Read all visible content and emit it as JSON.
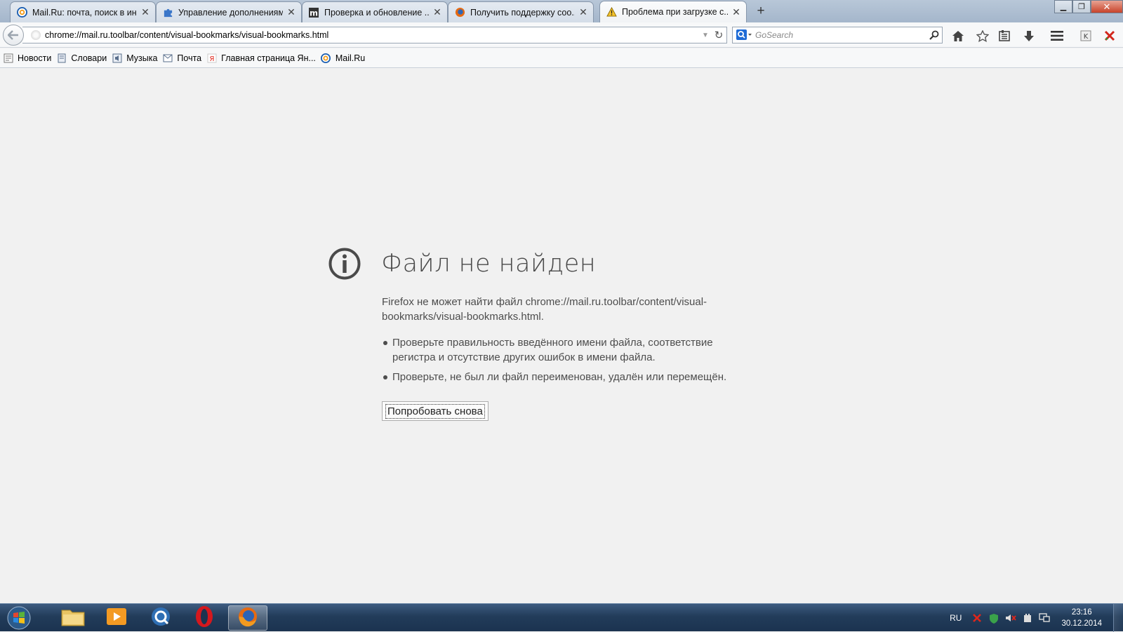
{
  "tabs": [
    {
      "label": "Mail.Ru: почта, поиск в ин...",
      "icon": "mailru-at-icon"
    },
    {
      "label": "Управление дополнениями",
      "icon": "puzzle-icon"
    },
    {
      "label": "Проверка и обновление ...",
      "icon": "m-letter-icon"
    },
    {
      "label": "Получить поддержку соо...",
      "icon": "firefox-icon"
    },
    {
      "label": "Проблема при загрузке с...",
      "icon": "warning-icon",
      "active": true
    }
  ],
  "urlbar": {
    "value": "chrome://mail.ru.toolbar/content/visual-bookmarks/visual-bookmarks.html"
  },
  "search": {
    "placeholder": "GoSearch"
  },
  "bookmarks": [
    {
      "label": "Новости",
      "icon": "news-icon"
    },
    {
      "label": "Словари",
      "icon": "dictionary-icon"
    },
    {
      "label": "Музыка",
      "icon": "music-icon"
    },
    {
      "label": "Почта",
      "icon": "mail-icon"
    },
    {
      "label": "Главная страница Ян...",
      "icon": "yandex-icon"
    },
    {
      "label": "Mail.Ru",
      "icon": "mailru-at-icon"
    }
  ],
  "error": {
    "title": "Файл не найден",
    "description": "Firefox не может найти файл chrome://mail.ru.toolbar/content/visual-bookmarks/visual-bookmarks.html.",
    "hints": [
      "Проверьте правильность введённого имени файла, соответствие регистра и отсутствие других ошибок в имени файла.",
      "Проверьте, не был ли файл переименован, удалён или перемещён."
    ],
    "retry_label": "Попробовать снова"
  },
  "taskbar": {
    "language": "RU",
    "time": "23:16",
    "date": "30.12.2014"
  },
  "colors": {
    "tabbar": "#a4b6cb",
    "content_bg": "#f1f1f1",
    "taskbar": "#223c5a",
    "error_text": "#4d4d4d"
  }
}
